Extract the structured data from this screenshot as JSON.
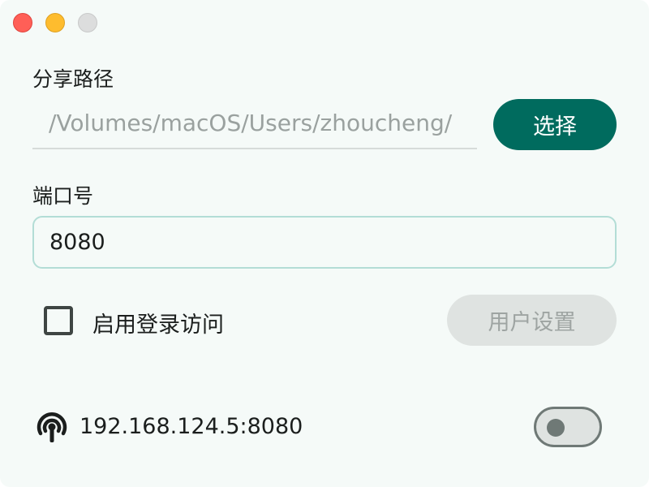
{
  "window": {
    "controls": [
      "close",
      "minimize",
      "maximize"
    ]
  },
  "share_path": {
    "label": "分享路径",
    "value": "/Volumes/macOS/Users/zhoucheng/",
    "choose_button": "选择"
  },
  "port": {
    "label": "端口号",
    "value": "8080"
  },
  "login": {
    "checkbox_label": "启用登录访问",
    "checked": false,
    "user_settings_button": "用户设置",
    "user_settings_enabled": false
  },
  "server": {
    "icon": "broadcast-icon",
    "address": "192.168.124.5:8080",
    "running": false
  },
  "colors": {
    "accent": "#006b5e",
    "background": "#f5faf8",
    "field_border": "#b3ddd6",
    "disabled_bg": "#dfe3e1",
    "close": "#ff5f57",
    "minimize": "#febc2e",
    "maximize_disabled": "#dcdddd"
  }
}
